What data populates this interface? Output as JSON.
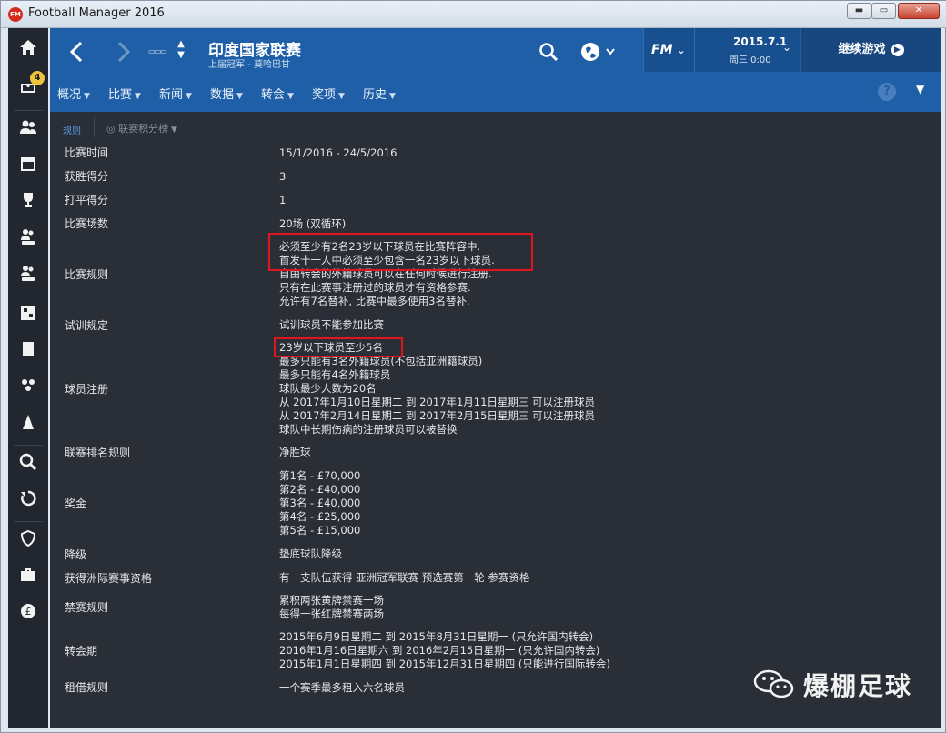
{
  "window": {
    "title": "Football Manager 2016",
    "min": "▬",
    "max": "▭",
    "close": "✕"
  },
  "sidebar": {
    "badge_count": "4"
  },
  "header": {
    "title": "印度国家联赛",
    "subtitle": "上届冠军 - 莫哈巴甘",
    "fm_label": "FM",
    "date": "2015.7.1",
    "date_sub": "周三 0:00",
    "continue_label": "继续游戏"
  },
  "menu": {
    "items": [
      {
        "label": "概况"
      },
      {
        "label": "比赛"
      },
      {
        "label": "新闻"
      },
      {
        "label": "数据"
      },
      {
        "label": "转会"
      },
      {
        "label": "奖项"
      },
      {
        "label": "历史"
      }
    ],
    "help": "?"
  },
  "subtabs": {
    "rules": "规则",
    "table": "联赛积分榜"
  },
  "rules": [
    {
      "label": "比赛时间",
      "lines": [
        "15/1/2016 - 24/5/2016"
      ]
    },
    {
      "label": "获胜得分",
      "lines": [
        "3"
      ]
    },
    {
      "label": "打平得分",
      "lines": [
        "1"
      ]
    },
    {
      "label": "比赛场数",
      "lines": [
        "20场 (双循环)"
      ]
    },
    {
      "label": "比赛规则",
      "lines": [
        "必须至少有2名23岁以下球员在比赛阵容中.",
        "首发十一人中必须至少包含一名23岁以下球员.",
        "自由转会的外籍球员可以在任何时候进行注册.",
        "只有在此赛事注册过的球员才有资格参赛.",
        "允许有7名替补, 比赛中最多使用3名替补."
      ]
    },
    {
      "label": "试训规定",
      "lines": [
        "试训球员不能参加比赛"
      ]
    },
    {
      "label": "球员注册",
      "lines": [
        "23岁以下球员至少5名",
        "最多只能有3名外籍球员(不包括亚洲籍球员)",
        "最多只能有4名外籍球员",
        "球队最少人数为20名",
        "从 2017年1月10日星期二 到 2017年1月11日星期三 可以注册球员",
        "从 2017年2月14日星期二 到 2017年2月15日星期三 可以注册球员",
        "球队中长期伤病的注册球员可以被替换"
      ]
    },
    {
      "label": "联赛排名规则",
      "lines": [
        "净胜球"
      ]
    },
    {
      "label": "奖金",
      "lines": [
        "第1名 - £70,000",
        "第2名 - £40,000",
        "第3名 - £40,000",
        "第4名 - £25,000",
        "第5名 - £15,000"
      ]
    },
    {
      "label": "降级",
      "lines": [
        "垫底球队降级"
      ]
    },
    {
      "label": "获得洲际赛事资格",
      "lines": [
        "有一支队伍获得 亚洲冠军联赛 预选赛第一轮 参赛资格"
      ]
    },
    {
      "label": "禁赛规则",
      "lines": [
        "累积两张黄牌禁赛一场",
        "每得一张红牌禁赛两场"
      ]
    },
    {
      "label": "转会期",
      "lines": [
        "2015年6月9日星期二 到 2015年8月31日星期一 (只允许国内转会)",
        "2016年1月16日星期六 到 2016年2月15日星期一 (只允许国内转会)",
        "2015年1月1日星期四 到 2015年12月31日星期四 (只能进行国际转会)"
      ]
    },
    {
      "label": "租借规则",
      "lines": [
        "一个赛季最多租入六名球员"
      ]
    }
  ],
  "watermark": {
    "text": "爆棚足球"
  },
  "colors": {
    "header_blue": "#1e5fa7",
    "content_bg": "#2a2e36",
    "highlight_red": "#e2141c",
    "sidebar": "#22272f"
  }
}
